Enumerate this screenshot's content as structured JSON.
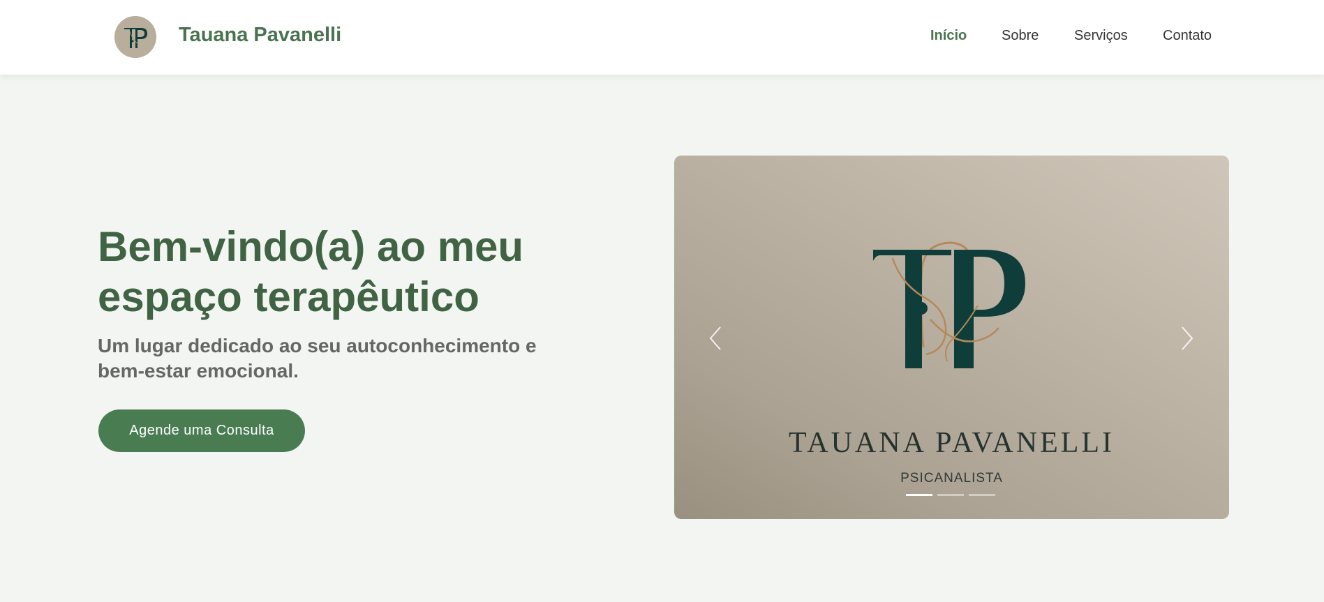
{
  "header": {
    "brand_name": "Tauana Pavanelli",
    "logo_icon": "tp-monogram-icon",
    "nav": [
      {
        "label": "Início",
        "active": true
      },
      {
        "label": "Sobre",
        "active": false
      },
      {
        "label": "Serviços",
        "active": false
      },
      {
        "label": "Contato",
        "active": false
      }
    ]
  },
  "hero": {
    "title": "Bem-vindo(a) ao meu espaço terapêutico",
    "subtitle": "Um lugar dedicado ao seu autoconhecimento e bem-estar emocional.",
    "cta_label": "Agende uma Consulta"
  },
  "carousel": {
    "slide": {
      "title": "TAUANA PAVANELLI",
      "subtitle": "PSICANALISTA",
      "logo_icon": "tp-monogram-icon"
    },
    "prev_icon": "chevron-left-icon",
    "next_icon": "chevron-right-icon",
    "slide_count": 3,
    "active_index": 0
  },
  "colors": {
    "brand_green": "#4a7350",
    "button_green": "#4a7c52",
    "monogram_teal": "#0f3d3a",
    "monogram_gold": "#b48a5a",
    "page_background": "#f3f5f2"
  }
}
